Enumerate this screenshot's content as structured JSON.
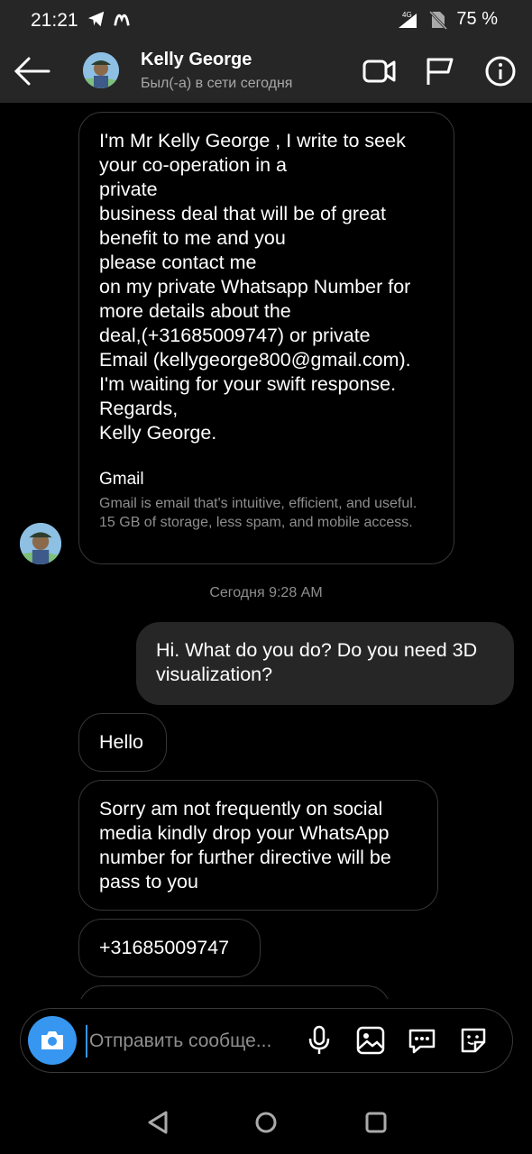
{
  "status_bar": {
    "time": "21:21",
    "network": "4G",
    "battery": "75 %"
  },
  "header": {
    "name": "Kelly George",
    "status": "Был(-а) в сети сегодня",
    "icons": [
      "back-arrow-icon",
      "video-call-icon",
      "flag-icon",
      "info-icon"
    ]
  },
  "messages": [
    {
      "sender": "them",
      "text": "I'm Mr Kelly George , I write to seek\nyour co-operation in a\nprivate\nbusiness deal that will be of great\nbenefit to me and you\nplease contact me\non my private Whatsapp Number for\nmore details about the\ndeal,(+31685009747) or private\nEmail (kellygeorge800@gmail.com).\nI'm waiting for your swift response.\nRegards,\nKelly George.",
      "preview_title": "Gmail",
      "preview_desc": "Gmail is email that's intuitive, efficient, and useful. 15 GB of storage, less spam, and mobile access."
    },
    {
      "sender": "me",
      "text": "Hi. What do you do?  Do you need 3D visualization?"
    },
    {
      "sender": "them",
      "text": "Hello"
    },
    {
      "sender": "them",
      "text": "Sorry am not frequently on social media kindly drop your WhatsApp number for further directive will be pass to you"
    },
    {
      "sender": "them",
      "text": "+31685009747"
    }
  ],
  "timestamp": "Сегодня 9:28 AM",
  "composer": {
    "placeholder": "Отправить сообще...",
    "icons": [
      "camera-icon",
      "microphone-icon",
      "gallery-icon",
      "chat-quick-reply-icon",
      "sticker-icon"
    ]
  },
  "colors": {
    "accent": "#3797f0",
    "bar_bg": "#262626",
    "bubble_border": "#363636"
  }
}
